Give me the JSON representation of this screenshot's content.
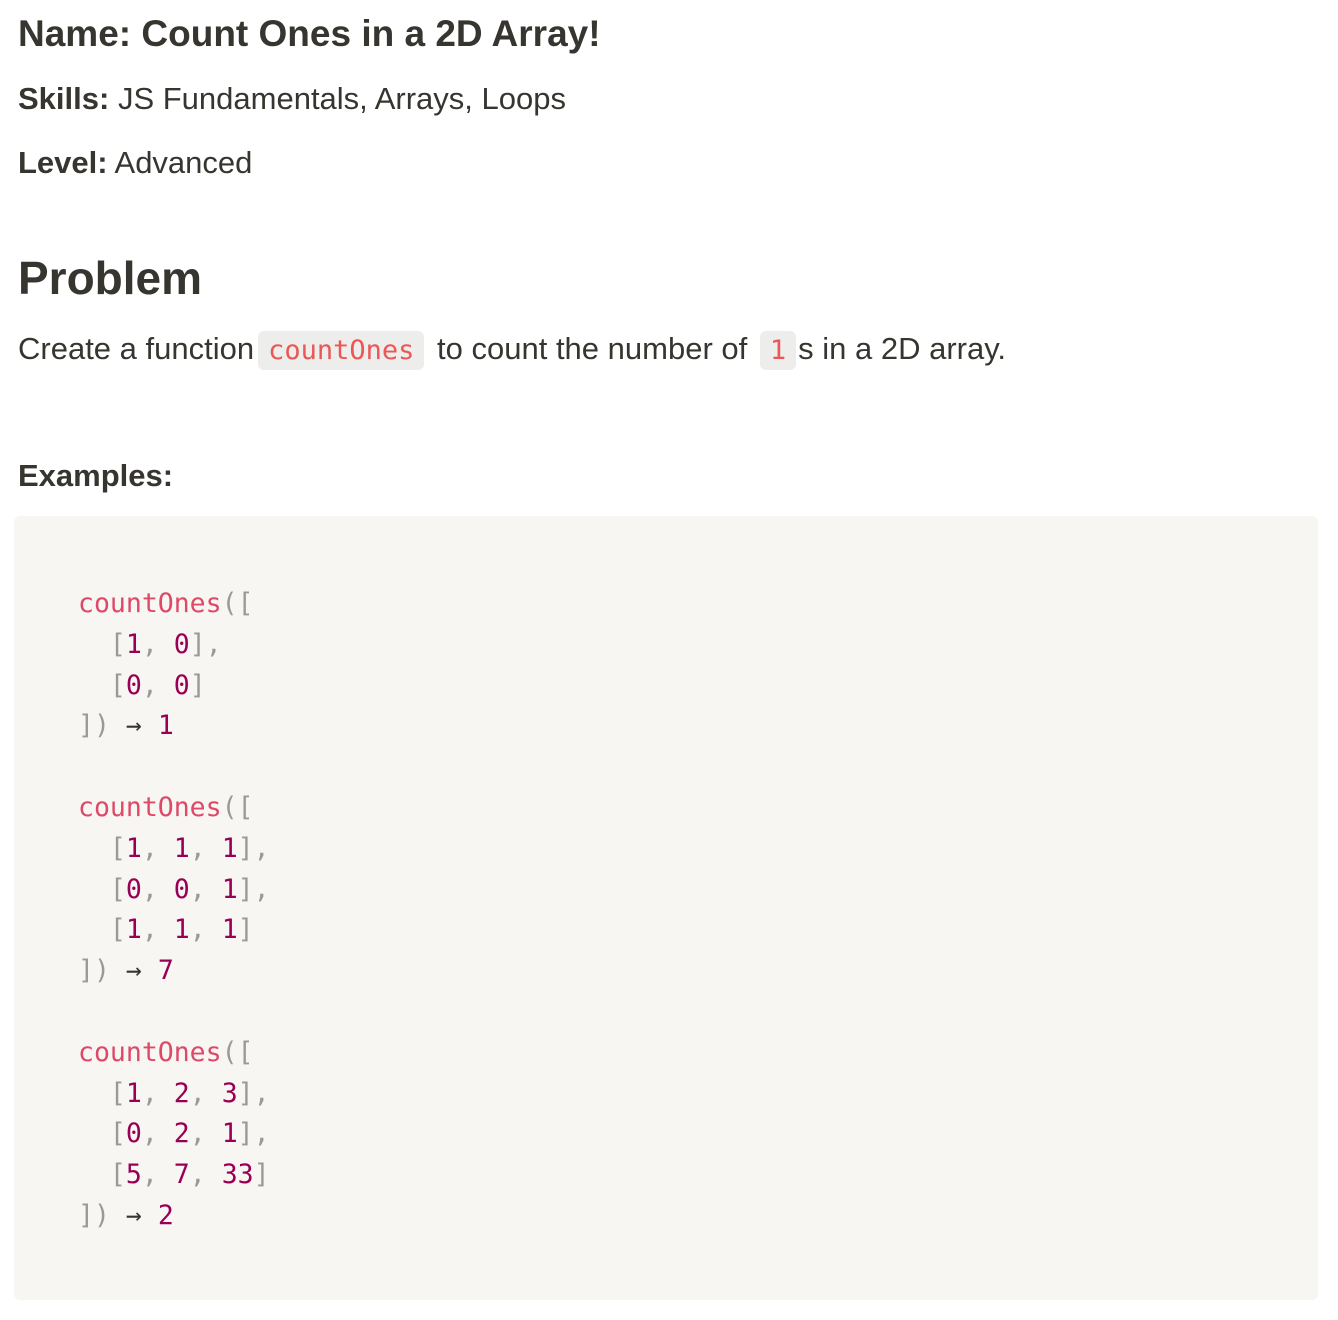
{
  "header": {
    "name_label": "Name:",
    "name_value": "Count Ones in a 2D Array!",
    "skills_label": "Skills:",
    "skills_value": "JS Fundamentals, Arrays, Loops",
    "level_label": "Level:",
    "level_value": "Advanced"
  },
  "problem": {
    "heading": "Problem",
    "text_before": "Create a function",
    "function_name": "countOnes",
    "text_middle": "to count the number of",
    "one_code": "1",
    "text_after": "s in a 2D array."
  },
  "examples": {
    "heading": "Examples:",
    "arrow": "→",
    "items": [
      {
        "function": "countOnes",
        "rows": [
          [
            "1",
            "0"
          ],
          [
            "0",
            "0"
          ]
        ],
        "result": "1"
      },
      {
        "function": "countOnes",
        "rows": [
          [
            "1",
            "1",
            "1"
          ],
          [
            "0",
            "0",
            "1"
          ],
          [
            "1",
            "1",
            "1"
          ]
        ],
        "result": "7"
      },
      {
        "function": "countOnes",
        "rows": [
          [
            "1",
            "2",
            "3"
          ],
          [
            "0",
            "2",
            "1"
          ],
          [
            "5",
            "7",
            "33"
          ]
        ],
        "result": "2"
      }
    ]
  }
}
